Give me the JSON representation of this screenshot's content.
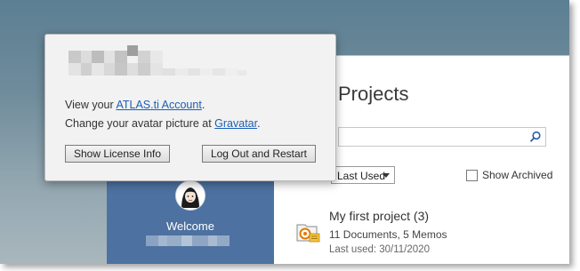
{
  "popup": {
    "line1_prefix": "View your ",
    "line1_link": "ATLAS.ti Account",
    "line1_suffix": ".",
    "line2_prefix": "Change your avatar picture at ",
    "line2_link": "Gravatar",
    "line2_suffix": ".",
    "show_license_label": "Show License Info",
    "logout_label": "Log Out and Restart"
  },
  "sidebar": {
    "welcome_label": "Welcome"
  },
  "main": {
    "title": "Projects",
    "search": {
      "value": "",
      "placeholder": ""
    },
    "sort": {
      "selected": "Last Used",
      "options": [
        "Last Used"
      ]
    },
    "show_archived_label": "Show Archived",
    "projects": [
      {
        "name": "My first project (3)",
        "meta": "11 Documents, 5 Memos",
        "last_used": "Last used: 30/11/2020"
      }
    ]
  },
  "colors": {
    "sidebar": "#4d71a0",
    "link": "#1a5fb4",
    "desktop_top": "#5c7f93",
    "project_icon": "#e07b00"
  },
  "icons": {
    "search": "search-icon",
    "project": "project-icon",
    "avatar": "avatar"
  }
}
